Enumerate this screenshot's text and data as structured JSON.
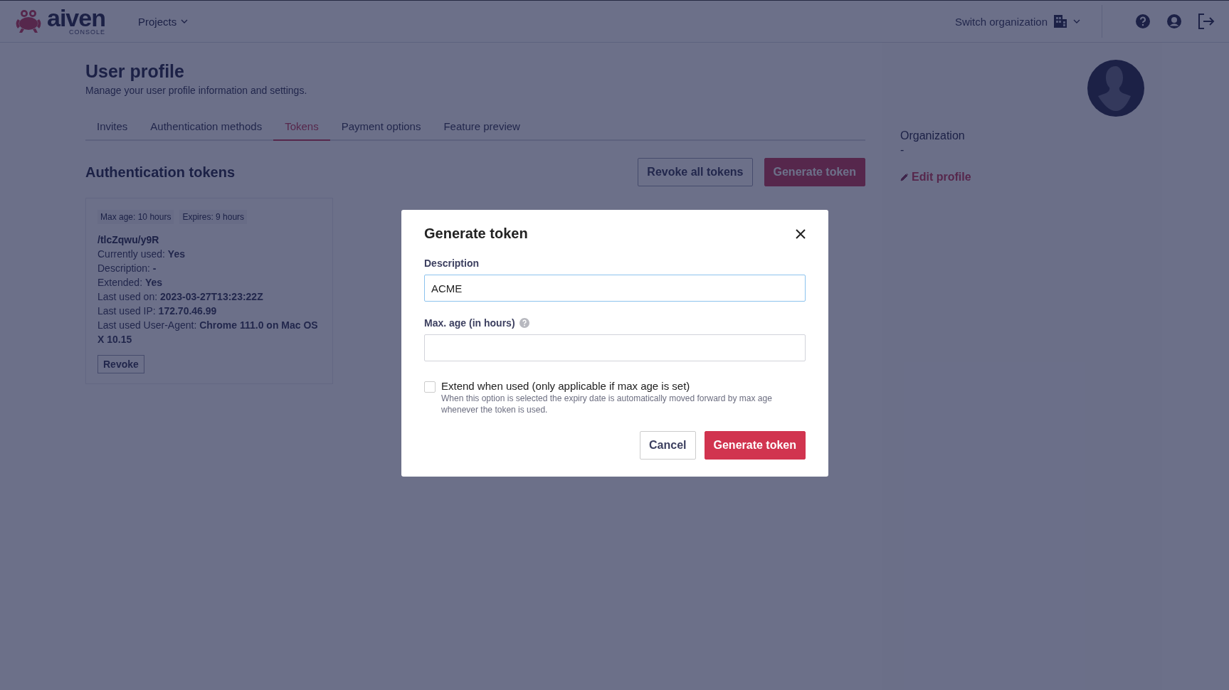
{
  "header": {
    "logo": "aiven",
    "logo_sub": "CONSOLE",
    "nav": [
      {
        "label": "Projects"
      }
    ],
    "switch_org": "Switch organization"
  },
  "page": {
    "title": "User profile",
    "subtitle": "Manage your user profile information and settings.",
    "tabs": [
      {
        "label": "Invites",
        "selected": false
      },
      {
        "label": "Authentication methods",
        "selected": false
      },
      {
        "label": "Tokens",
        "selected": true
      },
      {
        "label": "Payment options",
        "selected": false
      },
      {
        "label": "Feature preview",
        "selected": false
      }
    ],
    "section_title": "Authentication tokens",
    "buttons": [
      {
        "label": "Revoke all tokens",
        "kind": "secondary"
      },
      {
        "label": "Generate token",
        "kind": "primary"
      }
    ],
    "tokens": [
      {
        "tags": [
          "Max age: 10 hours",
          "Expires: 9 hours"
        ],
        "name": "/tlcZqwu/y9R",
        "details": [
          "Currently used: **Yes**",
          "Description: **-**",
          "Extended: **Yes**",
          "Last used on: **2023-03-27T13:23:22Z**",
          "Last used IP: **172.70.46.99**",
          "Last used User-Agent: **Chrome 111.0 on Mac OS X 10.15**"
        ],
        "action": "Revoke"
      }
    ]
  },
  "side": {
    "label": "Organization",
    "value": "-",
    "edit": "Edit profile"
  },
  "modal": {
    "title": "Generate token",
    "fields": [
      {
        "label": "Description",
        "value": "ACME",
        "focused": true,
        "help": false
      },
      {
        "label": "Max. age (in hours)",
        "focused": false,
        "help": true
      }
    ],
    "checkbox": {
      "label": "Extend when used (only applicable if max age is set)",
      "hint": "When this option is selected the expiry date is automatically moved forward by max age whenever the token is used.",
      "checked": false
    },
    "buttons": [
      {
        "label": "Cancel",
        "kind": "secondary"
      },
      {
        "label": "Generate token",
        "kind": "primary"
      }
    ]
  }
}
